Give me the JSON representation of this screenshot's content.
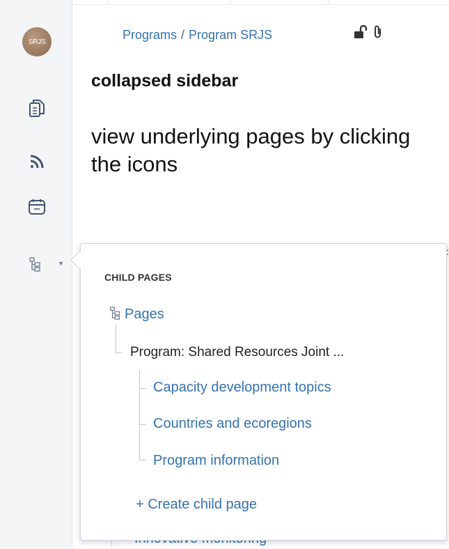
{
  "sidebar": {
    "avatar_initials": "SRJS",
    "icons": [
      "pages-icon",
      "rss-feed-icon",
      "calendar-icon",
      "page-tree-icon"
    ]
  },
  "header": {
    "breadcrumb": [
      "Programs",
      "Program SRJS"
    ],
    "breadcrumb_separator": "/",
    "status_icons": [
      "unlock-icon",
      "attachment-icon"
    ]
  },
  "main": {
    "title": "collapsed sidebar",
    "body": "view underlying pages by clicking the icons",
    "underlying_link": "Innovative monitoring"
  },
  "popup": {
    "heading": "CHILD PAGES",
    "root_label": "Pages",
    "parent_page": "Program: Shared Resources Joint ...",
    "children": [
      "Capacity development topics",
      "Countries and ecoregions",
      "Program information"
    ],
    "create_label": "+ Create child page"
  },
  "colors": {
    "link": "#3572b0",
    "sidebar_bg": "#f4f5f7"
  }
}
